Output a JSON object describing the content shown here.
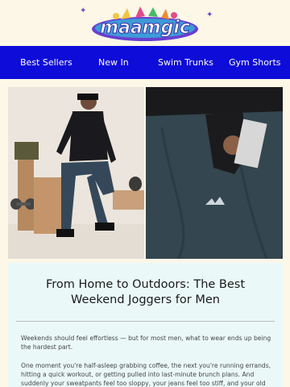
{
  "brand": {
    "logo_text": "maamgic"
  },
  "nav": {
    "items": [
      {
        "label": "Best Sellers"
      },
      {
        "label": "New In"
      },
      {
        "label": "Swim Trunks"
      },
      {
        "label": "Gym Shorts"
      }
    ]
  },
  "colors": {
    "nav_background": "#0d0cd8",
    "page_background": "#fcf7e7",
    "card_background": "#eaf9f8"
  },
  "article": {
    "title": "From Home to Outdoors: The Best Weekend Joggers for Men",
    "paragraph_1": "Weekends should feel effortless — but for most men, what to wear ends up being the hardest part.",
    "paragraph_2": "One moment you're half-asleep grabbing coffee, the next you're running errands, hitting a quick workout, or getting pulled into last-minute brunch plans. And suddenly your sweatpants feel too sloppy, your jeans feel too stiff, and your old"
  }
}
